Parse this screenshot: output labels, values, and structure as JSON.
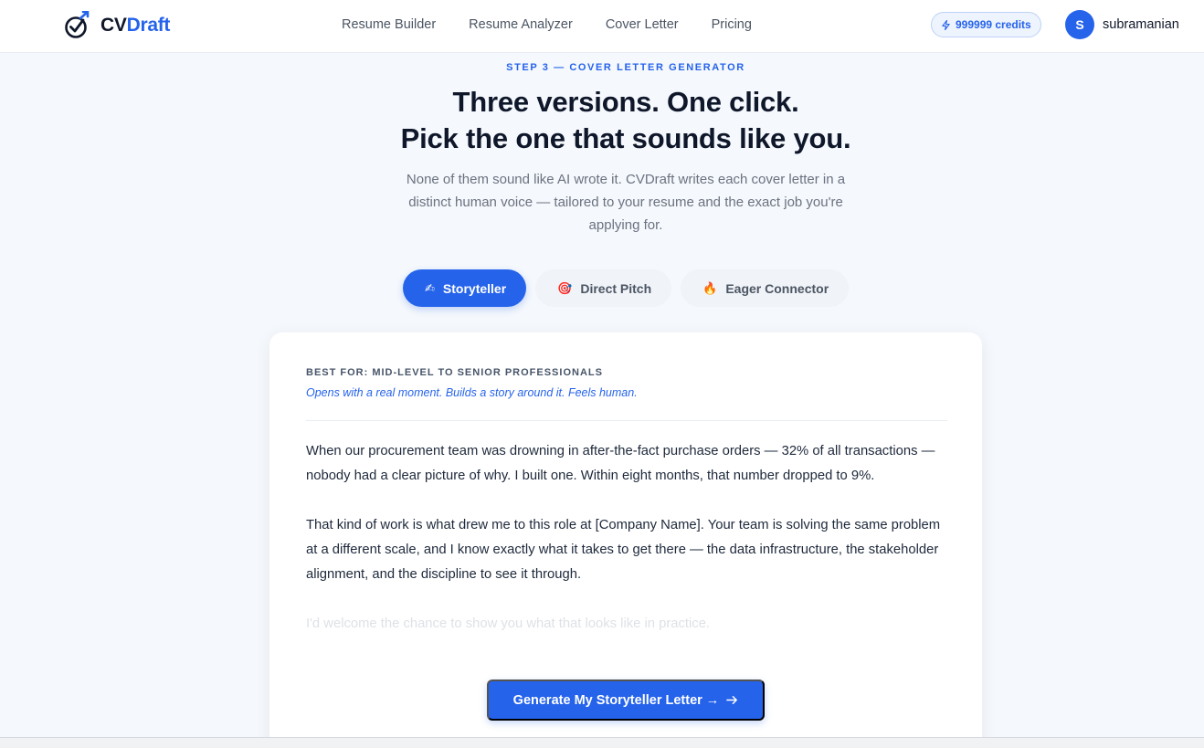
{
  "brand": {
    "cv": "CV",
    "draft": "Draft",
    "accent": "#2563eb"
  },
  "nav": {
    "links": [
      {
        "label": "Resume Builder"
      },
      {
        "label": "Resume Analyzer"
      },
      {
        "label": "Cover Letter"
      },
      {
        "label": "Pricing"
      }
    ],
    "credits": "999999 credits",
    "credits_icon": "lightning-icon",
    "user": {
      "initial": "S",
      "name": "subramanian"
    }
  },
  "hero": {
    "eyebrow": "STEP 3 — COVER LETTER GENERATOR",
    "headline_line1": "Three versions. One click.",
    "headline_line2": "Pick the one that sounds like you.",
    "subtext": "None of them sound like AI wrote it. CVDraft writes each cover letter in a distinct human voice — tailored to your resume and the exact job you're applying for."
  },
  "tabs": [
    {
      "icon": "✍",
      "icon_name": "writing-hand-icon",
      "label": "Storyteller",
      "active": true
    },
    {
      "icon": "🎯",
      "icon_name": "target-icon",
      "label": "Direct Pitch",
      "active": false
    },
    {
      "icon": "🔥",
      "icon_name": "fire-icon",
      "label": "Eager Connector",
      "active": false
    }
  ],
  "card": {
    "best_for": "BEST FOR: MID-LEVEL TO SENIOR PROFESSIONALS",
    "tagline": "Opens with a real moment. Builds a story around it. Feels human.",
    "paragraphs": [
      "When our procurement team was drowning in after-the-fact purchase orders — 32% of all transactions — nobody had a clear picture of why. I built one. Within eight months, that number dropped to 9%.",
      "That kind of work is what drew me to this role at [Company Name]. Your team is solving the same problem at a different scale, and I know exactly what it takes to get there — the data infrastructure, the stakeholder alignment, and the discipline to see it through.",
      "I'd welcome the chance to show you what that looks like in practice."
    ],
    "cta_label": "Generate My Storyteller Letter →"
  }
}
